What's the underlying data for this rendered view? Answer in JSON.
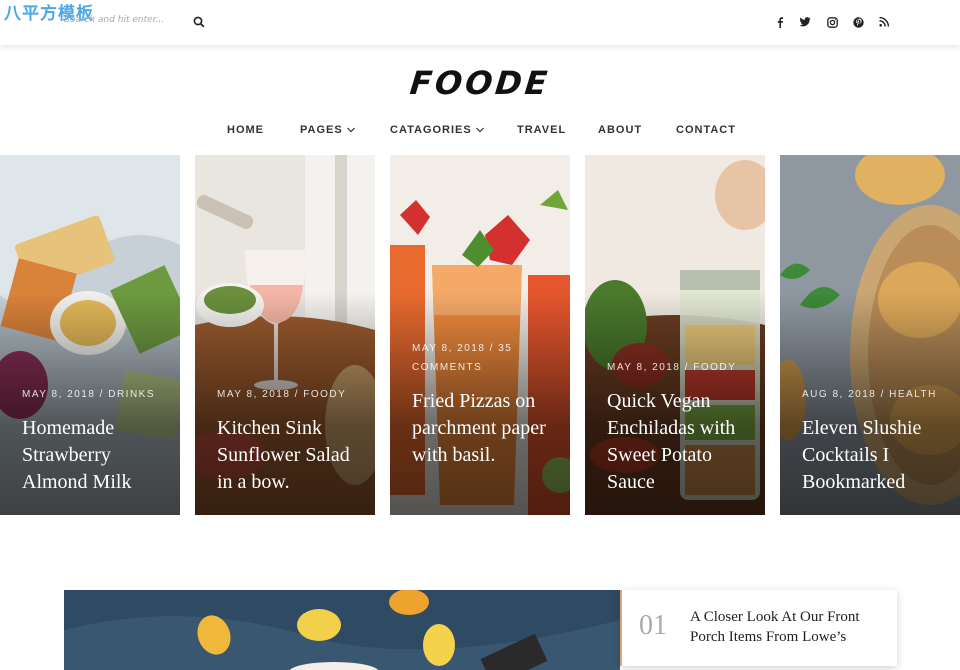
{
  "watermark": "八平方模板",
  "search": {
    "placeholder": "Search and hit enter..."
  },
  "social": [
    {
      "icon": "facebook-icon",
      "glyph": "f"
    },
    {
      "icon": "twitter-icon",
      "glyph": "t"
    },
    {
      "icon": "instagram-icon",
      "glyph": "i"
    },
    {
      "icon": "pinterest-icon",
      "glyph": "p"
    },
    {
      "icon": "rss-icon",
      "glyph": "r"
    }
  ],
  "logo": "FOODE",
  "nav": [
    {
      "label": "HOME",
      "dropdown": false
    },
    {
      "label": "PAGES",
      "dropdown": true
    },
    {
      "label": "CATAGORIES",
      "dropdown": true
    },
    {
      "label": "TRAVEL",
      "dropdown": false
    },
    {
      "label": "ABOUT",
      "dropdown": false
    },
    {
      "label": "CONTACT",
      "dropdown": false
    }
  ],
  "cards": [
    {
      "meta": "MAY 8, 2018 / DRINKS",
      "title": "Homemade Strawberry Almond Milk"
    },
    {
      "meta": "MAY 8, 2018 / FOODY",
      "title": "Kitchen Sink Sunflower Salad in a bow."
    },
    {
      "meta": "MAY 8, 2018 / 35 COMMENTS",
      "title": "Fried Pizzas on parchment paper with basil."
    },
    {
      "meta": "MAY 8, 2018 / FOODY",
      "title": "Quick Vegan Enchiladas with Sweet Potato Sauce"
    },
    {
      "meta": "AUG 8, 2018 / HEALTH",
      "title": "Eleven Slushie Cocktails I Bookmarked"
    }
  ],
  "feature": {
    "number": "01",
    "title": "A Closer Look At Our Front Porch Items From Lowe’s"
  },
  "colors": {
    "accent": "#e0a37a",
    "watermark": "#4aa8e8"
  }
}
